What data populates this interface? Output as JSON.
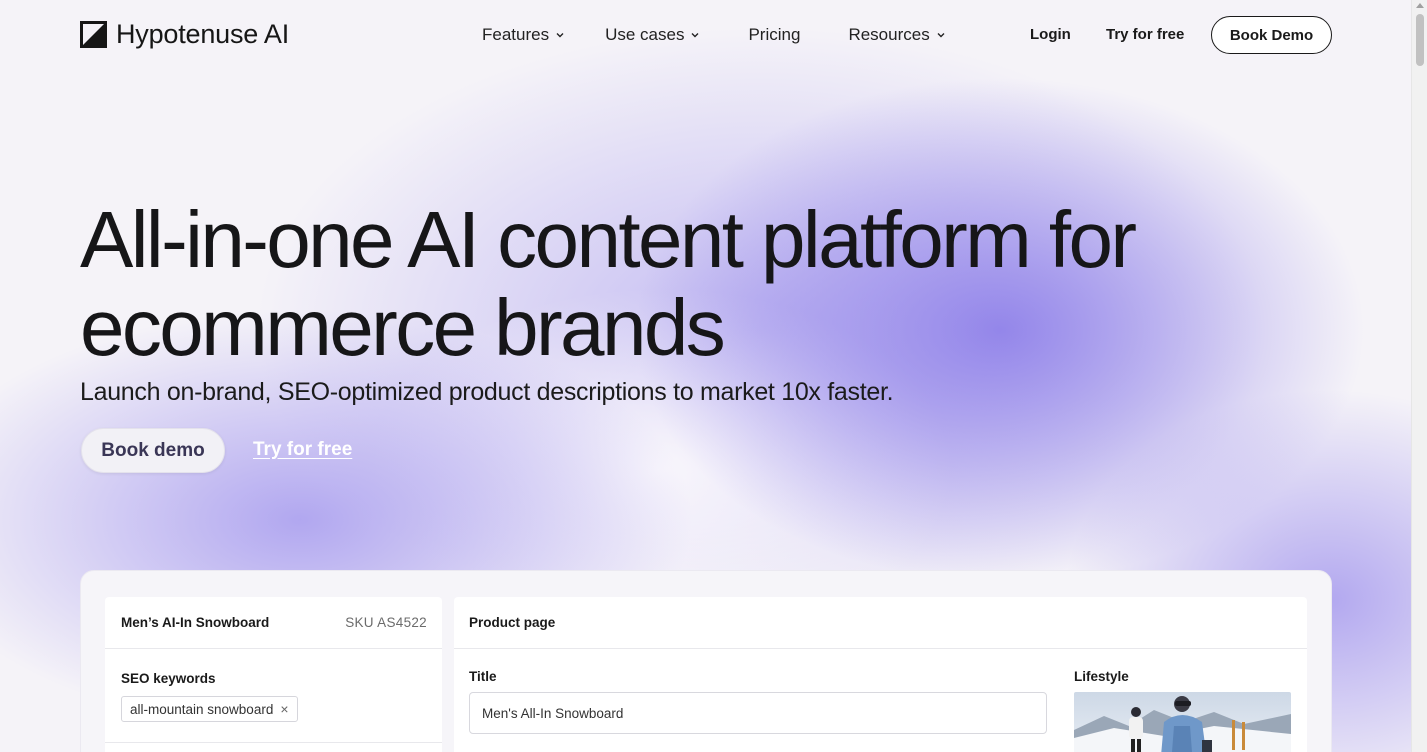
{
  "header": {
    "logo_text": "Hypotenuse AI",
    "nav": [
      {
        "label": "Features",
        "has_dropdown": true
      },
      {
        "label": "Use cases",
        "has_dropdown": true
      },
      {
        "label": "Pricing",
        "has_dropdown": false
      },
      {
        "label": "Resources",
        "has_dropdown": true
      }
    ],
    "login_label": "Login",
    "try_label": "Try for free",
    "book_demo_label": "Book Demo"
  },
  "hero": {
    "title_line1": "All-in-one AI content platform for",
    "title_line2": "ecommerce brands",
    "subtitle": "Launch on-brand, SEO-optimized product descriptions to market 10x faster.",
    "book_demo_label": "Book demo",
    "try_label": "Try for free"
  },
  "app_preview": {
    "product_name": "Men’s AI-In Snowboard",
    "sku": "SKU AS4522",
    "seo_label": "SEO keywords",
    "keyword_chip": "all-mountain snowboard",
    "chip_remove": "×",
    "product_page_label": "Product page",
    "title_label": "Title",
    "title_value": "Men's All-In Snowboard",
    "lifestyle_label": "Lifestyle"
  },
  "colors": {
    "accent_purple": "#8778e8",
    "text_dark": "#161616",
    "background": "#f5f3f8"
  }
}
